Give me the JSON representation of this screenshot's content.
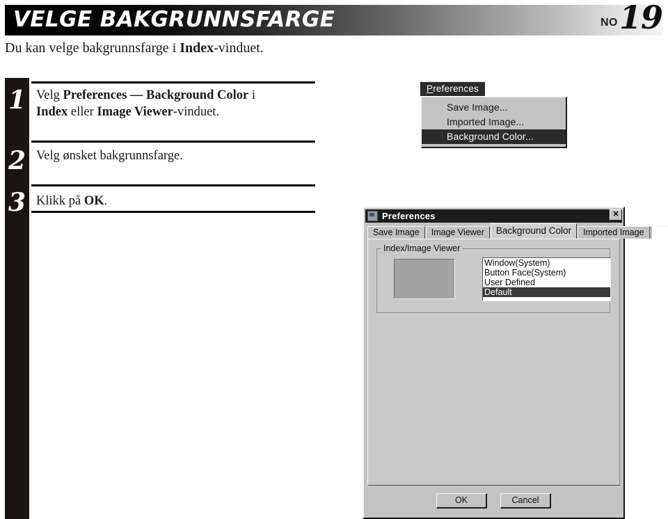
{
  "header": {
    "title": "VELGE BAKGRUNNSFARGE",
    "language_code": "NO",
    "page_number": "19",
    "gradient_start": "#000000",
    "gradient_end": "#f4f4f4"
  },
  "intro": {
    "prefix": "Du kan velge bakgrunnsfarge i ",
    "bold": "Index",
    "suffix": "-vinduet."
  },
  "steps": [
    {
      "number": "1",
      "line1_part1": "Velg ",
      "line1_bold1": "Preferences — Background Color",
      "line1_part2": " i",
      "line2_bold1": "Index",
      "line2_part1": " eller ",
      "line2_bold2": "Image Viewer",
      "line2_part2": "-vinduet."
    },
    {
      "number": "2",
      "text": "Velg ønsket bakgrunnsfarge."
    },
    {
      "number": "3",
      "prefix": "Klikk på ",
      "bold": "OK",
      "suffix": "."
    }
  ],
  "menu_screenshot": {
    "menubar_item": "Preferences",
    "menubar_mnemonic": "P",
    "items": [
      {
        "label": "Save Image...",
        "mnemonic": "S",
        "selected": false
      },
      {
        "label": "Imported Image...",
        "mnemonic": "I",
        "selected": false
      },
      {
        "label": "Background Color...",
        "mnemonic": "B",
        "selected": true
      }
    ]
  },
  "dialog": {
    "title": "Preferences",
    "close_label": "✕",
    "tabs": [
      {
        "label": "Save Image",
        "active": false
      },
      {
        "label": "Image Viewer",
        "active": false
      },
      {
        "label": "Background Color",
        "active": true
      },
      {
        "label": "Imported Image",
        "active": false
      }
    ],
    "groupbox": {
      "label": "Index/Image Viewer",
      "swatch_color": "#a3a3a3",
      "list_items": [
        {
          "label": "Window(System)",
          "selected": false
        },
        {
          "label": "Button Face(System)",
          "selected": false
        },
        {
          "label": "User Defined",
          "selected": false
        },
        {
          "label": "Default",
          "selected": true
        }
      ]
    },
    "buttons": {
      "ok": "OK",
      "cancel": "Cancel"
    }
  }
}
